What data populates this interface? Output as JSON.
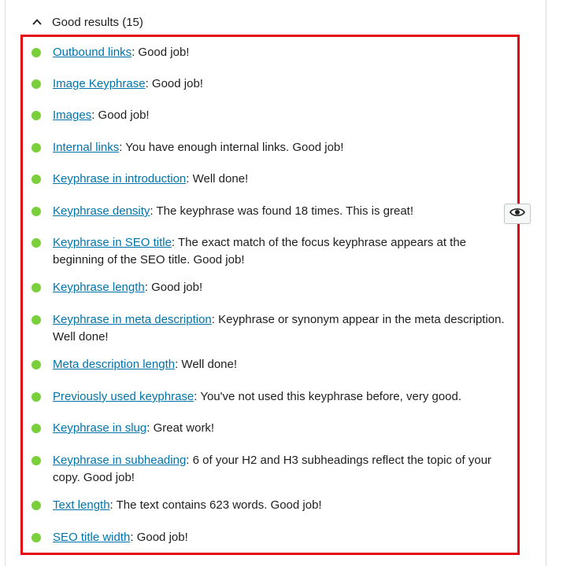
{
  "section": {
    "title": "Good results (15)",
    "icon": "chevron-up-icon"
  },
  "colors": {
    "bullet": "#7ad03a",
    "link": "#0073aa",
    "highlight_border": "#e30613"
  },
  "results": [
    {
      "link": "Outbound links",
      "text": ": Good job!"
    },
    {
      "link": "Image Keyphrase",
      "text": ": Good job!"
    },
    {
      "link": "Images",
      "text": ": Good job!"
    },
    {
      "link": "Internal links",
      "text": ": You have enough internal links. Good job!"
    },
    {
      "link": "Keyphrase in introduction",
      "text": ": Well done!"
    },
    {
      "link": "Keyphrase density",
      "text": ": The keyphrase was found 18 times. This is great!"
    },
    {
      "link": "Keyphrase in SEO title",
      "text": ": The exact match of the focus keyphrase appears at the beginning of the SEO title. Good job!"
    },
    {
      "link": "Keyphrase length",
      "text": ": Good job!"
    },
    {
      "link": "Keyphrase in meta description",
      "text": ": Keyphrase or synonym appear in the meta description. Well done!"
    },
    {
      "link": "Meta description length",
      "text": ": Well done!"
    },
    {
      "link": "Previously used keyphrase",
      "text": ": You've not used this keyphrase before, very good."
    },
    {
      "link": "Keyphrase in slug",
      "text": ": Great work!"
    },
    {
      "link": "Keyphrase in subheading",
      "text": ": 6 of your H2 and H3 subheadings reflect the topic of your copy. Good job!"
    },
    {
      "link": "Text length",
      "text": ": The text contains 623 words. Good job!"
    },
    {
      "link": "SEO title width",
      "text": ": Good job!"
    }
  ],
  "eye_button": {
    "icon": "eye-icon"
  }
}
